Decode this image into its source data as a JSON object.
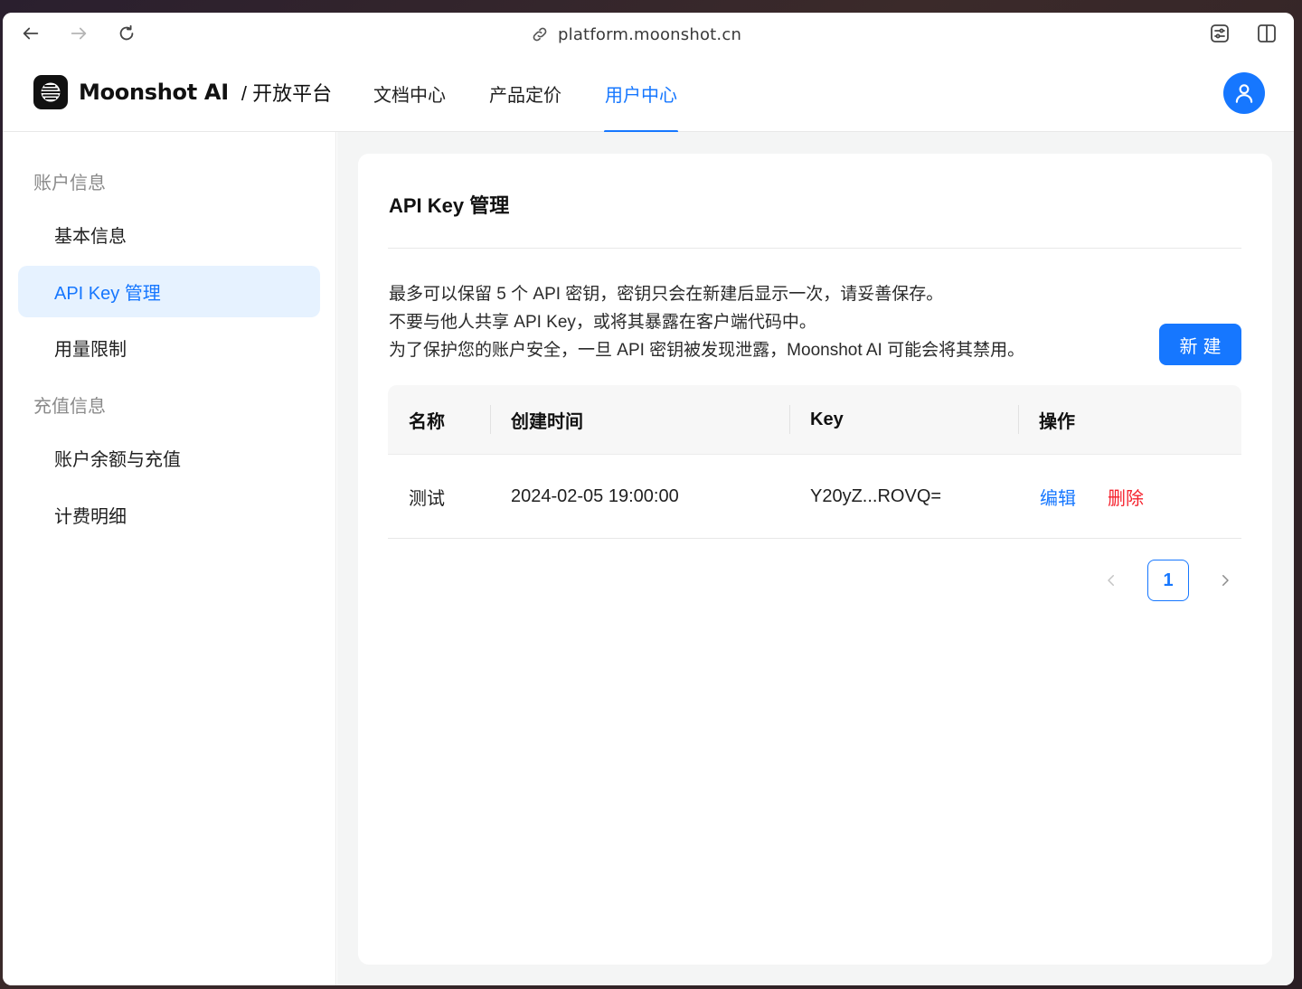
{
  "browser": {
    "url": "platform.moonshot.cn"
  },
  "header": {
    "brand_name": "Moonshot AI",
    "brand_sub": "/ 开放平台",
    "nav": [
      {
        "label": "文档中心",
        "active": false
      },
      {
        "label": "产品定价",
        "active": false
      },
      {
        "label": "用户中心",
        "active": true
      }
    ]
  },
  "sidebar": {
    "groups": [
      {
        "label": "账户信息"
      },
      {
        "label": "充值信息"
      }
    ],
    "items": [
      {
        "label": "基本信息",
        "active": false
      },
      {
        "label": "API Key 管理",
        "active": true
      },
      {
        "label": "用量限制",
        "active": false
      },
      {
        "label": "账户余额与充值",
        "active": false
      },
      {
        "label": "计费明细",
        "active": false
      }
    ]
  },
  "main": {
    "title": "API Key 管理",
    "notice": [
      "最多可以保留 5 个 API 密钥，密钥只会在新建后显示一次，请妥善保存。",
      "不要与他人共享 API Key，或将其暴露在客户端代码中。",
      "为了保护您的账户安全，一旦 API 密钥被发现泄露，Moonshot AI 可能会将其禁用。"
    ],
    "new_button": "新建",
    "table": {
      "headers": [
        "名称",
        "创建时间",
        "Key",
        "操作"
      ],
      "rows": [
        {
          "name": "测试",
          "created": "2024-02-05 19:00:00",
          "key": "Y20yZ...ROVQ=",
          "edit": "编辑",
          "delete": "删除"
        }
      ]
    },
    "pagination": {
      "current": "1"
    }
  },
  "colors": {
    "accent": "#1677ff",
    "danger": "#f5222d",
    "active_bg": "#e6f2ff"
  }
}
